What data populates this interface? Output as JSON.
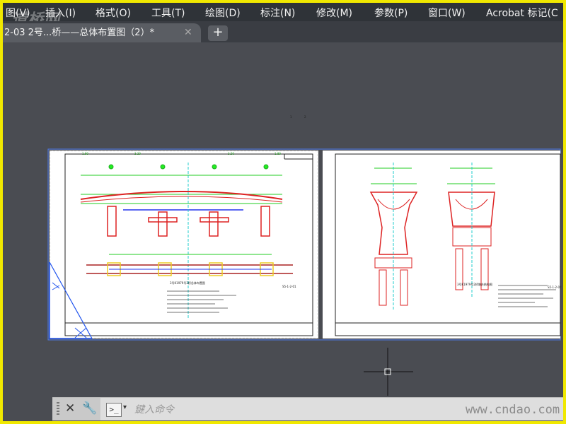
{
  "menu": {
    "items": [
      "图(V)",
      "插入(I)",
      "格式(O)",
      "工具(T)",
      "绘图(D)",
      "标注(N)",
      "修改(M)",
      "参数(P)",
      "窗口(W)",
      "Acrobat 标记(C"
    ]
  },
  "tab": {
    "title": "2-03 2号...桥——总体布置图（2）*",
    "close": "✕",
    "add": "+"
  },
  "drawing_left": {
    "sheet_title": "3号K1979号2桥总体布置图",
    "sheet_no": "S5-1-2-01",
    "page_box": [
      "1",
      "2"
    ],
    "elev_labels": [
      "1.80",
      "3.20",
      "3.50",
      "1.80"
    ]
  },
  "drawing_right": {
    "sheet_title": "3号K1979号2桥墩台结构图",
    "sheet_no": "S5-1-2-02"
  },
  "command": {
    "close": "✕",
    "settings": "🔧",
    "prompt_icon": ">_",
    "dropdown": "▾",
    "placeholder": "鍵入命令"
  },
  "watermarks": {
    "top": "道桥网",
    "bottom": "www.cndao.com"
  },
  "colors": {
    "frame": "#f0e800",
    "canvas": "#4a4c52",
    "menubar": "#2f3338",
    "paper": "#ffffff",
    "selection": "#4f7cf0"
  }
}
